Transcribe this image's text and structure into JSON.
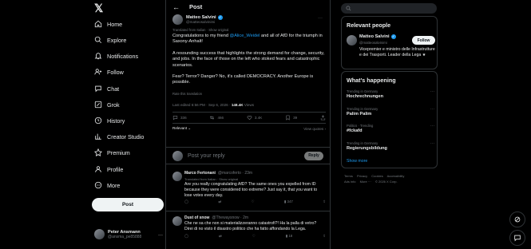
{
  "nav": {
    "items": [
      {
        "label": "Home",
        "icon": "home-icon"
      },
      {
        "label": "Explore",
        "icon": "search-icon"
      },
      {
        "label": "Notifications",
        "icon": "bell-icon"
      },
      {
        "label": "Follow",
        "icon": "follow-icon"
      },
      {
        "label": "Chat",
        "icon": "chat-icon"
      },
      {
        "label": "Grok",
        "icon": "grok-icon"
      },
      {
        "label": "History",
        "icon": "history-icon"
      },
      {
        "label": "Creator Studio",
        "icon": "creator-studio-icon"
      },
      {
        "label": "Premium",
        "icon": "premium-icon"
      },
      {
        "label": "Profile",
        "icon": "profile-icon"
      },
      {
        "label": "More",
        "icon": "more-icon"
      }
    ],
    "post_button": "Post",
    "account": {
      "name": "Peter Ansmann",
      "handle": "@ansma_pe85888",
      "more": "···"
    }
  },
  "header": {
    "title": "Post"
  },
  "tweet": {
    "author": "Matteo Salvini",
    "handle": "@matteosalvinimi",
    "translated_note": "Translated from Italian · Show original",
    "paragraph1_pre": "Congratulations to my friend ",
    "mention": "@Alice_Weidel",
    "paragraph1_post": " and all of AfD for the triumph in Saxony-Anhalt!",
    "paragraph2": "A resounding success that highlights the strong demand for change, security, and jobs. In the face of those on the left who stoked fears and catastrophic scenarios.",
    "paragraph3": "Fear? Terror? Danger? No, it's called DEMOCRACY. Another Europe is possible.",
    "rate": "Rate this translation",
    "meta_time": "Last edited 6:56 PM · Sep 6, 2026 · ",
    "views": "148.4K",
    "views_label": " Views",
    "actions": {
      "replies": "336",
      "reposts": "466",
      "likes": "3.4K",
      "bookmarks": "39"
    },
    "relevant": "Relevant ⌄",
    "view_quotes": "View quotes ›"
  },
  "reply_box": {
    "placeholder": "Post your reply",
    "button": "Reply"
  },
  "replies": [
    {
      "name": "Marco Fertonani",
      "meta": "@marcoferto · 23m",
      "translated": "Translated from Italian · Show original",
      "text": "Are you really congratulating AfD? The same ones you expelled from ID because they were considered too extreme? Just say it, that you want to lose votes every day.",
      "stats": {
        "replies": "",
        "reposts": "",
        "likes": "",
        "views": "347"
      }
    },
    {
      "name": "Dust of snow",
      "meta": "@Thewaysnow · 2m",
      "translated": "",
      "text": "Che ne sa che non si materializzeranno  catastrofi?! Ha la palla di vetro? Direi di no visto il disastro politico che ha fatto affondando la Lega.",
      "stats": {
        "replies": "",
        "reposts": "",
        "likes": "",
        "views": "18"
      }
    }
  ],
  "right": {
    "relevant_title": "Relevant people",
    "person": {
      "name": "Matteo Salvini",
      "handle": "@matteosalvinimi",
      "follow": "Follow",
      "bio": "Vicepremier e ministro delle Infrastrutture e dei Trasporti. Leader della Lega ★"
    },
    "happening_title": "What's happening",
    "trends": [
      {
        "context": "Trending in Germany",
        "name": "Hochrechnungen"
      },
      {
        "context": "Trending in Germany",
        "name": "Palim Palim"
      },
      {
        "context": "Politics · Trending",
        "name": "#fckafd"
      },
      {
        "context": "Trending in Germany",
        "name": "Regierungsbildung"
      }
    ],
    "show_more": "Show more",
    "footer": [
      "Terms",
      "Privacy",
      "Cookies",
      "Accessibility",
      "Ads info",
      "More ···",
      "© 2026 X Corp."
    ]
  },
  "colors": {
    "accent": "#1d9bf0",
    "background": "#000000",
    "border": "#2f3336"
  }
}
